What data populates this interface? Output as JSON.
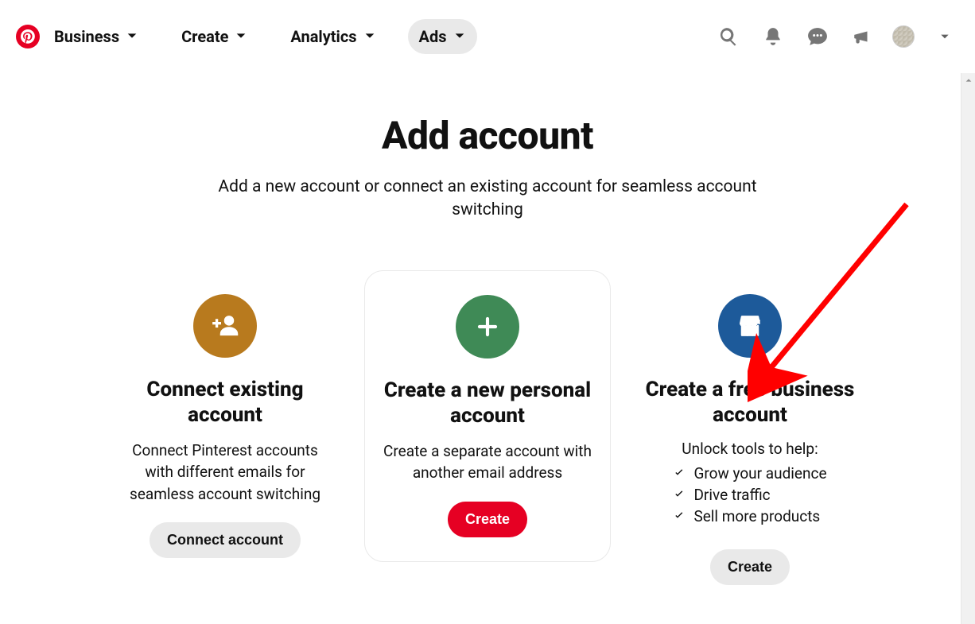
{
  "nav": {
    "items": [
      {
        "label": "Business"
      },
      {
        "label": "Create"
      },
      {
        "label": "Analytics"
      },
      {
        "label": "Ads"
      }
    ]
  },
  "main": {
    "title": "Add account",
    "subtitle": "Add a new account or connect an existing account for seamless account switching"
  },
  "cards": {
    "connect": {
      "title": "Connect existing account",
      "desc": "Connect Pinterest accounts with different emails for seamless account switching",
      "button": "Connect account"
    },
    "personal": {
      "title": "Create a new personal account",
      "desc": "Create a separate account with another email address",
      "button": "Create"
    },
    "business": {
      "title": "Create a free business account",
      "intro": "Unlock tools to help:",
      "bullets": [
        "Grow your audience",
        "Drive traffic",
        "Sell more products"
      ],
      "button": "Create"
    }
  }
}
